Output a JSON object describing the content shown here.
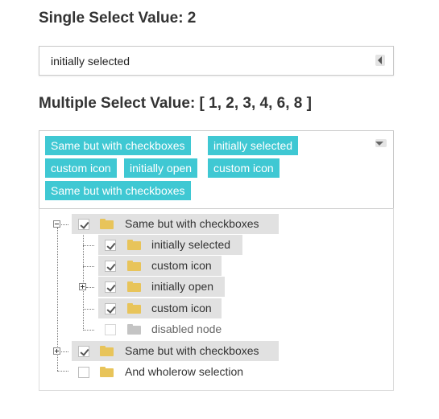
{
  "single": {
    "heading": "Single Select Value: 2",
    "value": "initially selected"
  },
  "multi": {
    "heading": "Multiple Select Value: [ 1, 2, 3, 4, 6, 8 ]",
    "tags": [
      "Same but with checkboxes",
      "initially selected",
      "custom icon",
      "initially open",
      "custom icon",
      "Same but with checkboxes"
    ]
  },
  "tree": {
    "nodes": [
      {
        "label": "Same but with checkboxes",
        "checked": true,
        "icon": "folder-icon"
      },
      {
        "label": "initially selected",
        "checked": true,
        "icon": "folder-icon"
      },
      {
        "label": "custom icon",
        "checked": true,
        "icon": "folder-icon"
      },
      {
        "label": "initially open",
        "checked": true,
        "icon": "folder-icon"
      },
      {
        "label": "custom icon",
        "checked": true,
        "icon": "folder-icon"
      },
      {
        "label": "disabled node",
        "checked": false,
        "icon": "folder-icon",
        "disabled": true
      },
      {
        "label": "Same but with checkboxes",
        "checked": true,
        "icon": "folder-icon"
      },
      {
        "label": "And wholerow selection",
        "checked": false,
        "icon": "folder-icon"
      }
    ]
  },
  "colors": {
    "tag_bg": "#3fc8d3",
    "folder": "#e8c45a",
    "selected_row": "#e1e1e1"
  }
}
